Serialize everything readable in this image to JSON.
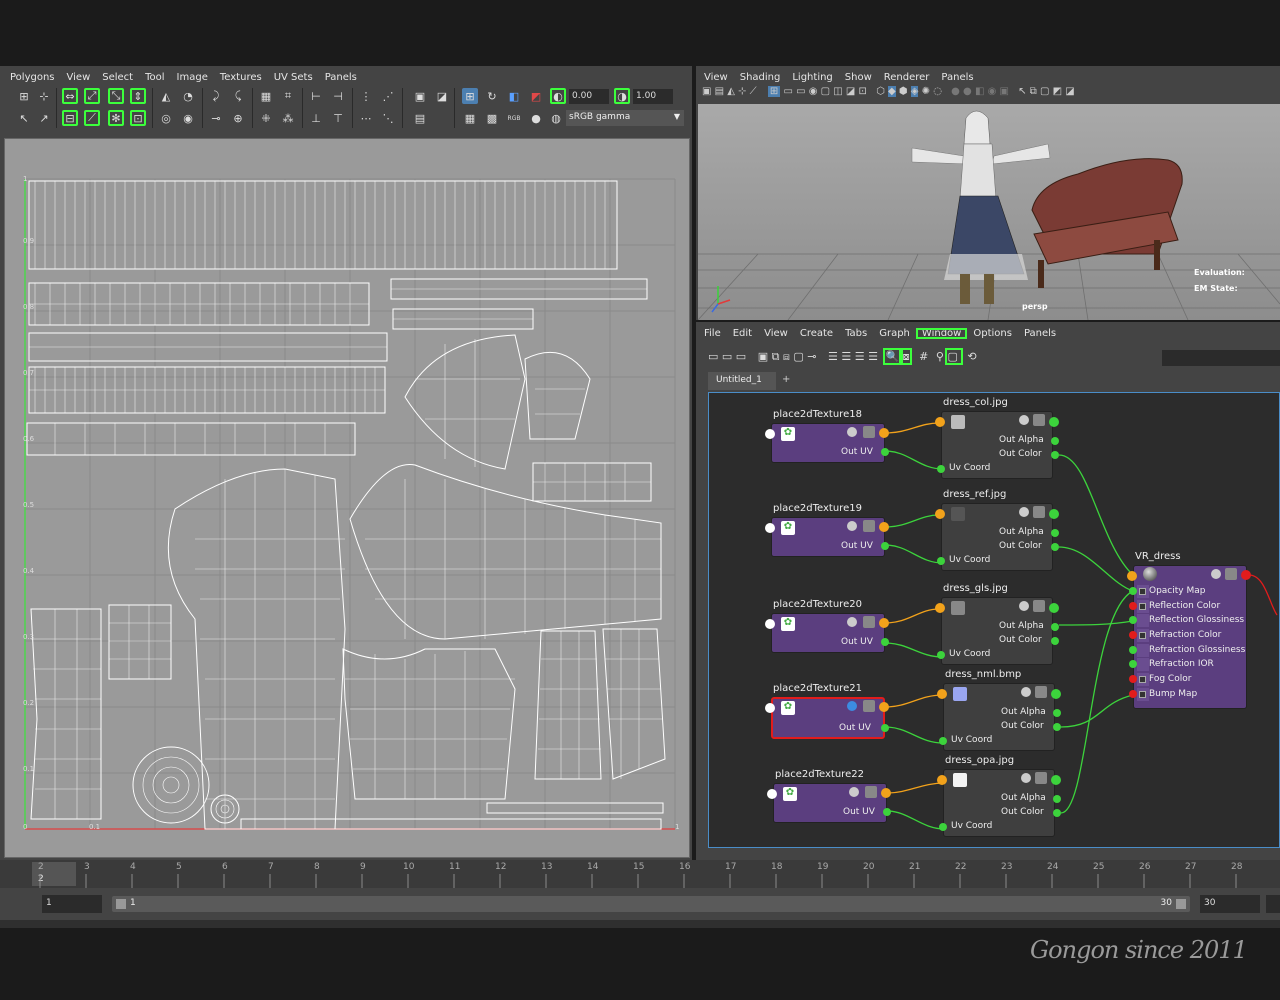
{
  "uv_editor": {
    "menu": [
      "Polygons",
      "View",
      "Select",
      "Tool",
      "Image",
      "Textures",
      "UV Sets",
      "Panels"
    ],
    "field_a": "0.00",
    "field_b": "1.00",
    "colorspace": "sRGB gamma",
    "v_ticks": [
      "1",
      "0.9",
      "0.8",
      "0.7",
      "0.6",
      "0.5",
      "0.4",
      "0.3",
      "0.2",
      "0.1",
      "0"
    ],
    "u_tick_end": "1",
    "u_tick_mid": "0.1"
  },
  "viewport": {
    "menu": [
      "View",
      "Shading",
      "Lighting",
      "Show",
      "Renderer",
      "Panels"
    ],
    "camera_label": "persp",
    "hud_eval": "Evaluation:",
    "hud_em": "EM State:"
  },
  "hypershade": {
    "menu": [
      "File",
      "Edit",
      "View",
      "Create",
      "Tabs",
      "Graph",
      "Window",
      "Options",
      "Panels"
    ],
    "active_menu": "Window",
    "tab": "Untitled_1",
    "tab_add": "+",
    "nodes": {
      "p18": {
        "title": "place2dTexture18",
        "out": "Out UV"
      },
      "p19": {
        "title": "place2dTexture19",
        "out": "Out UV"
      },
      "p20": {
        "title": "place2dTexture20",
        "out": "Out UV"
      },
      "p21": {
        "title": "place2dTexture21",
        "out": "Out UV"
      },
      "p22": {
        "title": "place2dTexture22",
        "out": "Out UV"
      },
      "f1": {
        "title": "dress_col.jpg",
        "alpha": "Out Alpha",
        "color": "Out Color",
        "uv": "Uv Coord"
      },
      "f2": {
        "title": "dress_ref.jpg",
        "alpha": "Out Alpha",
        "color": "Out Color",
        "uv": "Uv Coord"
      },
      "f3": {
        "title": "dress_gls.jpg",
        "alpha": "Out Alpha",
        "color": "Out Color",
        "uv": "Uv Coord"
      },
      "f4": {
        "title": "dress_nml.bmp",
        "alpha": "Out Alpha",
        "color": "Out Color",
        "uv": "Uv Coord"
      },
      "f5": {
        "title": "dress_opa.jpg",
        "alpha": "Out Alpha",
        "color": "Out Color",
        "uv": "Uv Coord"
      },
      "shader": {
        "title": "VR_dress",
        "attrs": [
          "Opacity Map",
          "Reflection Color",
          "Reflection Glossiness",
          "Refraction Color",
          "Refraction Glossiness",
          "Refraction IOR",
          "Fog Color",
          "Bump Map"
        ]
      }
    }
  },
  "timeline": {
    "ticks": [
      "2",
      "3",
      "4",
      "5",
      "6",
      "7",
      "8",
      "9",
      "10",
      "11",
      "12",
      "13",
      "14",
      "15",
      "16",
      "17",
      "18",
      "19",
      "20",
      "21",
      "22",
      "23",
      "24",
      "25",
      "26",
      "27",
      "28"
    ],
    "current": "2",
    "range_start": "1",
    "range_inner_start": "1",
    "range_inner_end": "30",
    "range_end": "30"
  },
  "signature": "Gongon since 2011",
  "colors": {
    "accent_green": "#3cff3c",
    "node_purple": "#5b3e7f",
    "wire_green": "#3cd33c",
    "wire_orange": "#f2a21b",
    "select_red": "#e21c1c"
  }
}
